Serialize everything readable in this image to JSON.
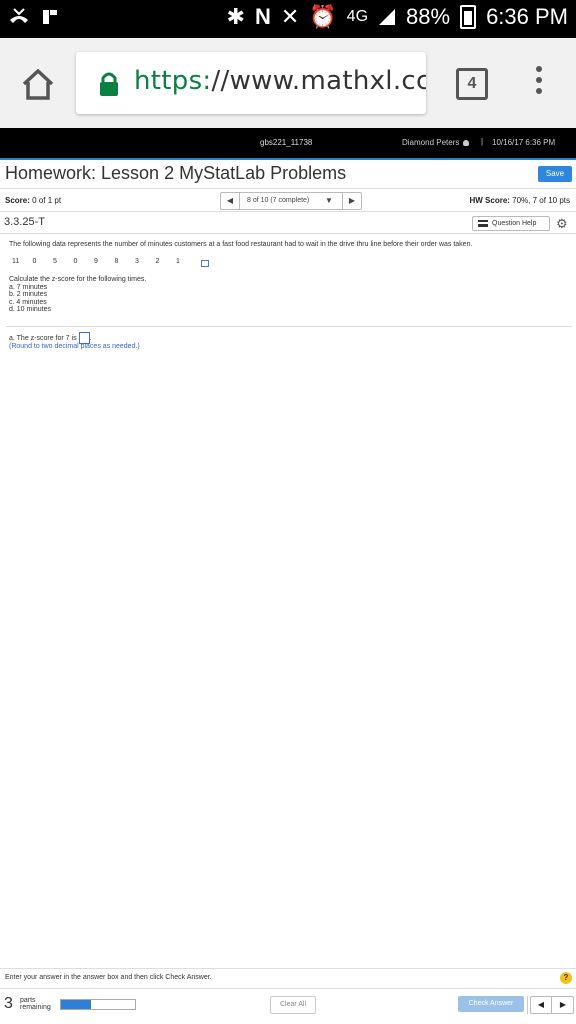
{
  "statusbar": {
    "network": "4G",
    "battery": "88%",
    "time": "6:36 PM"
  },
  "browser": {
    "url_scheme": "https:",
    "url_rest": "//www.mathxl.cc",
    "tab_count": "4"
  },
  "site": {
    "course": "gbs221_11738",
    "user": "Diamond Peters",
    "separator": "|",
    "datetime": "10/16/17 6:36 PM"
  },
  "header": {
    "title": "Homework: Lesson 2 MyStatLab Problems",
    "save_label": "Save"
  },
  "score": {
    "label": "Score:",
    "value": "0 of 1 pt",
    "nav_text": "8 of 10 (7 complete)",
    "hw_label": "HW Score:",
    "hw_value": "70%, 7 of 10 pts"
  },
  "question": {
    "id": "3.3.25-T",
    "help_label": "Question Help",
    "prompt": "The following data represents the number of minutes customers at a fast food restaurant had to wait in the drive thru line before their order was taken.",
    "data": [
      "11",
      "0",
      "5",
      "0",
      "9",
      "8",
      "3",
      "2",
      "1"
    ],
    "calc_intro": "Calculate the z-score for the following times.",
    "items": [
      "a. 7 minutes",
      "b. 2 minutes",
      "c. 4 minutes",
      "d. 10 minutes"
    ],
    "part_a": "a. The z-score for 7 is",
    "part_a_end": ".",
    "round_note": "(Round to two decimal places as needed.)"
  },
  "footer": {
    "instruction": "Enter your answer in the answer box and then click Check Answer.",
    "parts_count": "3",
    "parts_label_1": "parts",
    "parts_label_2": "remaining",
    "progress_fraction": 0.4,
    "clear_label": "Clear All",
    "check_label": "Check Answer"
  },
  "colors": {
    "accent": "#2e86de",
    "url_scheme": "#0b8043",
    "link": "#3b62c7"
  }
}
